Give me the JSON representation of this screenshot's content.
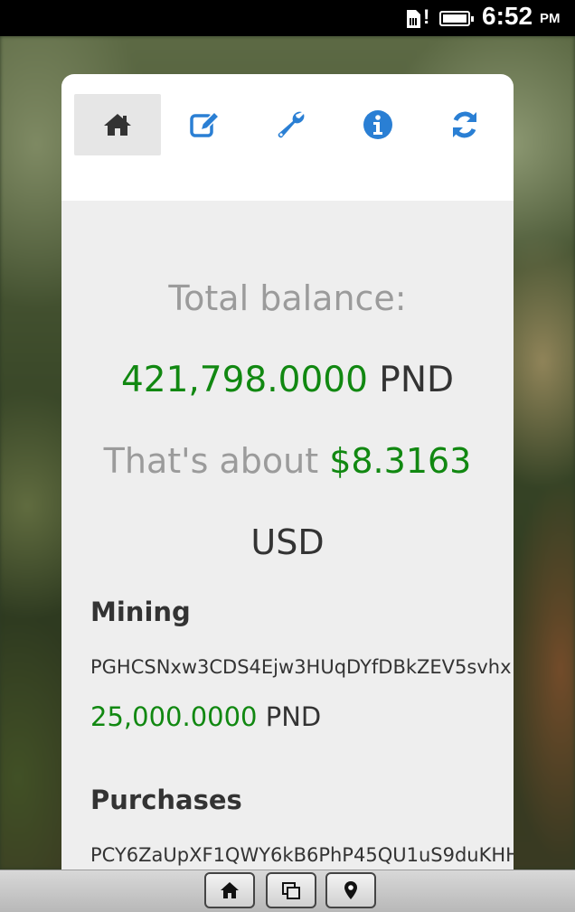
{
  "status_bar": {
    "time": "6:52",
    "ampm": "PM",
    "icons": [
      "sim-card-icon",
      "alert-icon",
      "battery-icon"
    ]
  },
  "tabs": [
    {
      "name": "home",
      "icon": "home-icon",
      "active": true
    },
    {
      "name": "edit",
      "icon": "edit-icon",
      "active": false
    },
    {
      "name": "settings",
      "icon": "wrench-icon",
      "active": false
    },
    {
      "name": "info",
      "icon": "info-icon",
      "active": false
    },
    {
      "name": "refresh",
      "icon": "refresh-icon",
      "active": false
    }
  ],
  "summary": {
    "total_label": "Total balance:",
    "balance_value": "421,798.0000",
    "balance_unit": "PND",
    "about_prefix": "That's about",
    "usd_value": "$8.3163",
    "usd_unit": "USD"
  },
  "accounts": [
    {
      "title": "Mining",
      "address": "PGHCSNxw3CDS4Ejw3HUqDYfDBkZEV5svhx",
      "amount": "25,000.0000",
      "unit": "PND"
    },
    {
      "title": "Purchases",
      "address": "PCY6ZaUpXF1QWY6kB6PhP45QU1uS9duKHH"
    }
  ],
  "bottom_bar": {
    "buttons": [
      "home-icon",
      "windows-icon",
      "location-pin-icon"
    ]
  },
  "colors": {
    "accent_blue": "#2a7fd4",
    "amount_green": "#118811",
    "muted_text": "#9b9b9b"
  }
}
